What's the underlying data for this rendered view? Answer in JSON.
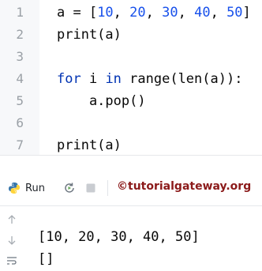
{
  "editor": {
    "lines": [
      {
        "number": "1",
        "parts": [
          {
            "text": "a = [",
            "style": "plain"
          },
          {
            "text": "10",
            "style": "num"
          },
          {
            "text": ", ",
            "style": "plain"
          },
          {
            "text": "20",
            "style": "num"
          },
          {
            "text": ", ",
            "style": "plain"
          },
          {
            "text": "30",
            "style": "num"
          },
          {
            "text": ", ",
            "style": "plain"
          },
          {
            "text": "40",
            "style": "num"
          },
          {
            "text": ", ",
            "style": "plain"
          },
          {
            "text": "50",
            "style": "num"
          },
          {
            "text": "]",
            "style": "plain"
          }
        ]
      },
      {
        "number": "2",
        "parts": [
          {
            "text": "print(a)",
            "style": "plain"
          }
        ]
      },
      {
        "number": "3",
        "parts": []
      },
      {
        "number": "4",
        "parts": [
          {
            "text": "for",
            "style": "kw"
          },
          {
            "text": " i ",
            "style": "plain"
          },
          {
            "text": "in",
            "style": "kw"
          },
          {
            "text": " range(len(a)):",
            "style": "plain"
          }
        ]
      },
      {
        "number": "5",
        "parts": [
          {
            "text": "    a.pop()",
            "style": "plain"
          }
        ]
      },
      {
        "number": "6",
        "parts": []
      },
      {
        "number": "7",
        "parts": [
          {
            "text": "print(a)",
            "style": "plain"
          }
        ]
      }
    ]
  },
  "toolbar": {
    "run_label": "Run",
    "run_icon": "python-icon",
    "rerun_icon": "rerun-icon",
    "stop_icon": "stop-icon"
  },
  "watermark": "©tutorialgateway.org",
  "console": {
    "output": [
      "[10, 20, 30, 40, 50]",
      "[]"
    ],
    "icons": [
      "arrow-up-icon",
      "arrow-down-icon",
      "soft-wrap-icon"
    ]
  },
  "colors": {
    "number": "#1750eb",
    "keyword": "#0033b3",
    "watermark": "#8b1a1a"
  }
}
